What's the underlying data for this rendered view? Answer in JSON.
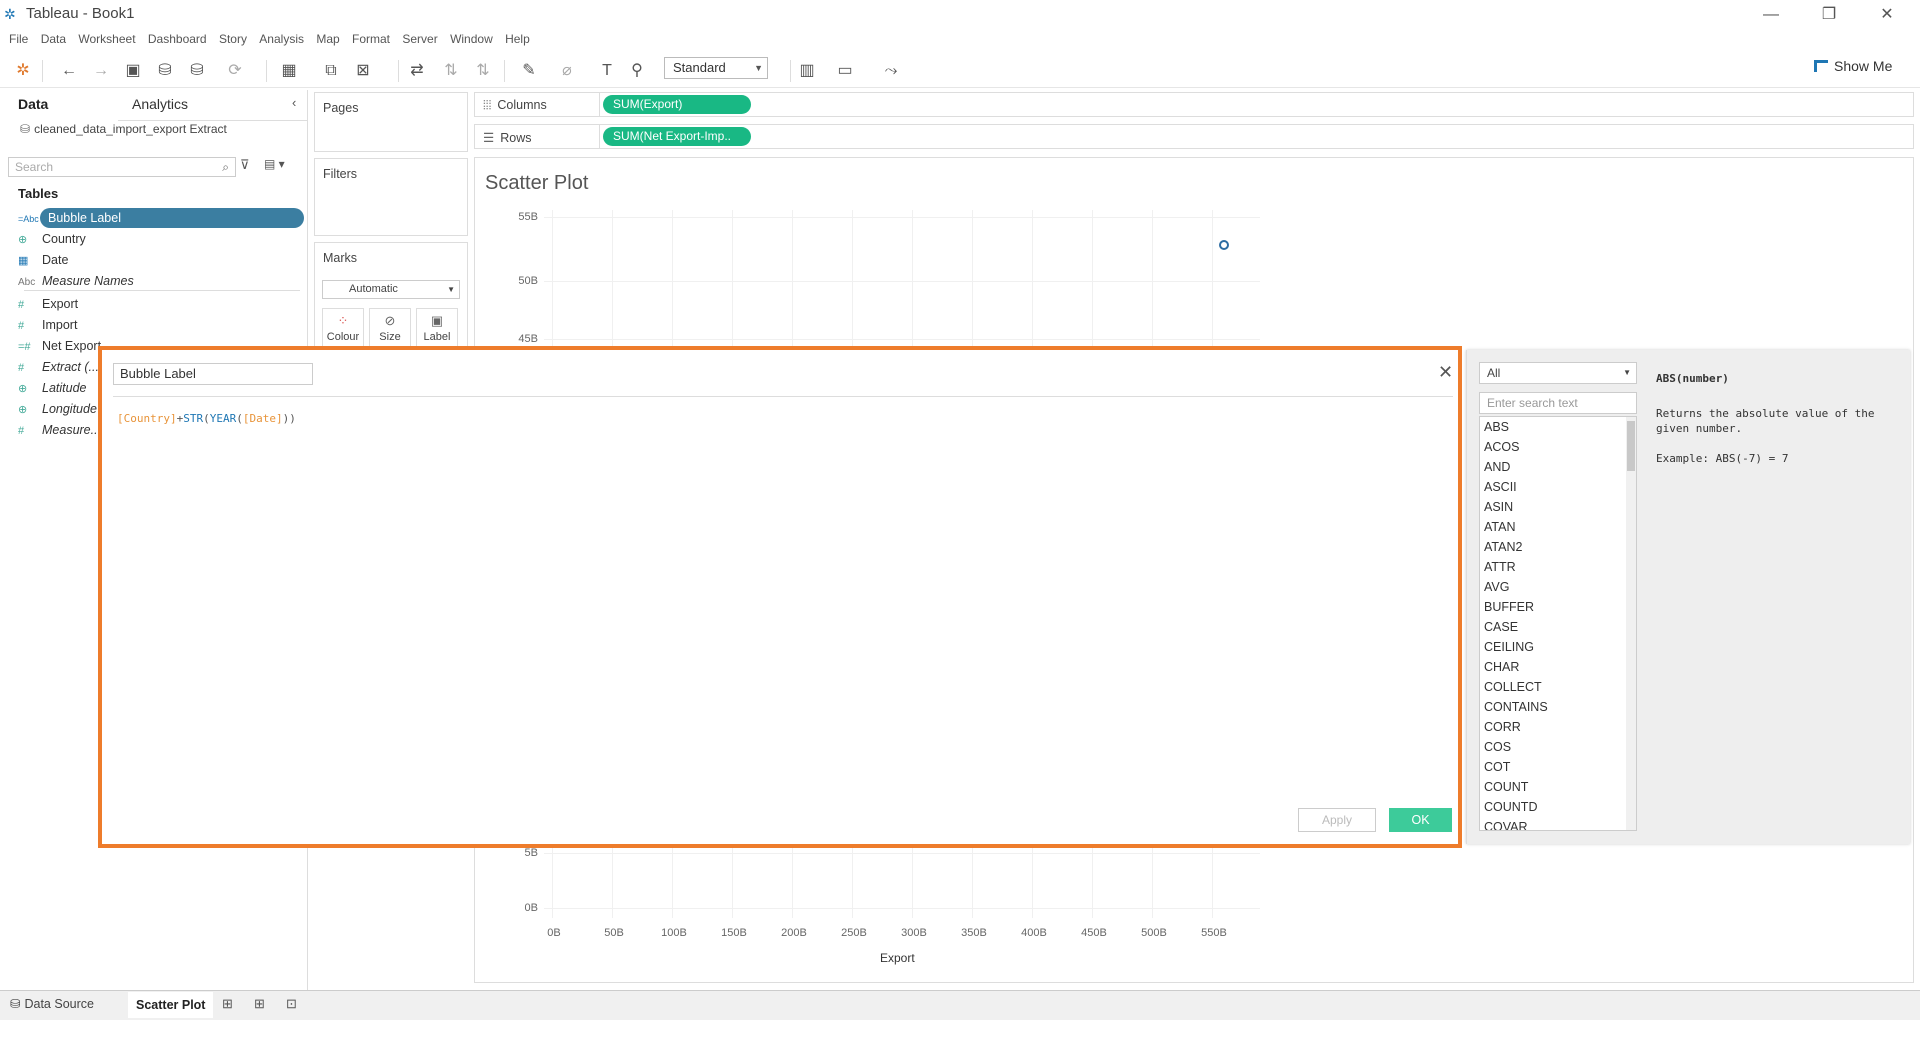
{
  "window": {
    "title": "Tableau - Book1"
  },
  "menu": [
    "File",
    "Data",
    "Worksheet",
    "Dashboard",
    "Story",
    "Analysis",
    "Map",
    "Format",
    "Server",
    "Window",
    "Help"
  ],
  "toolbar": {
    "fit": "Standard",
    "show_me": "Show Me"
  },
  "left_pane": {
    "tab_data": "Data",
    "tab_analytics": "Analytics",
    "datasource": "cleaned_data_import_export Extract",
    "search_placeholder": "Search",
    "tables_heading": "Tables",
    "fields": [
      {
        "icon": "=Abc",
        "name": "Bubble Label"
      },
      {
        "icon": "globe",
        "name": "Country"
      },
      {
        "icon": "calendar",
        "name": "Date"
      },
      {
        "icon": "Abc",
        "name": "Measure Names"
      },
      {
        "icon": "#",
        "name": "Export"
      },
      {
        "icon": "#",
        "name": "Import"
      },
      {
        "icon": "=#",
        "name": "Net Export..."
      },
      {
        "icon": "#",
        "name": "Extract (..."
      },
      {
        "icon": "globe",
        "name": "Latitude"
      },
      {
        "icon": "globe",
        "name": "Longitude"
      },
      {
        "icon": "#",
        "name": "Measure..."
      }
    ]
  },
  "cards": {
    "pages": "Pages",
    "filters": "Filters",
    "marks": "Marks",
    "mark_type": "Automatic",
    "colour": "Colour",
    "size": "Size",
    "label": "Label"
  },
  "shelves": {
    "columns_label": "Columns",
    "columns_pill": "SUM(Export)",
    "rows_label": "Rows",
    "rows_pill": "SUM(Net Export-Imp.."
  },
  "view": {
    "title": "Scatter Plot"
  },
  "chart_data": {
    "type": "scatter",
    "title": "Scatter Plot",
    "xlabel": "Export",
    "ylabel": "",
    "x_ticks": [
      "0B",
      "50B",
      "100B",
      "150B",
      "200B",
      "250B",
      "300B",
      "350B",
      "400B",
      "450B",
      "500B",
      "550B"
    ],
    "y_ticks_visible": [
      "55B",
      "50B",
      "45B",
      "5B",
      "0B"
    ],
    "xlim": [
      0,
      590
    ],
    "points": [
      {
        "x": 560,
        "y": 52.7
      }
    ]
  },
  "bottom_tabs": {
    "data_source": "Data Source",
    "sheet": "Scatter Plot"
  },
  "calc_dialog": {
    "name": "Bubble Label",
    "formula": {
      "f1": "[Country]",
      "plus": "+",
      "str": "STR",
      "p1": "(",
      "year": "YEAR",
      "p2": "(",
      "f2": "[Date]",
      "p3": "))"
    },
    "apply": "Apply",
    "ok": "OK"
  },
  "functions": {
    "category": "All",
    "search_placeholder": "Enter search text",
    "list": [
      "ABS",
      "ACOS",
      "AND",
      "ASCII",
      "ASIN",
      "ATAN",
      "ATAN2",
      "ATTR",
      "AVG",
      "BUFFER",
      "CASE",
      "CEILING",
      "CHAR",
      "COLLECT",
      "CONTAINS",
      "CORR",
      "COS",
      "COT",
      "COUNT",
      "COUNTD",
      "COVAR"
    ],
    "signature": "ABS(number)",
    "description": "Returns the absolute value of the given number.",
    "example": "Example: ABS(-7) = 7"
  },
  "colors": {
    "accent_green": "#19b884",
    "selected_field": "#3b7ea1",
    "dialog_border": "#ee7c2b",
    "ok_button": "#3dcb9a"
  }
}
